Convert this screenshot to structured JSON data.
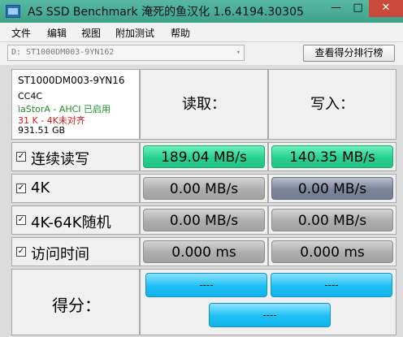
{
  "window": {
    "title": "AS SSD Benchmark 淹死的鱼汉化 1.6.4194.30305",
    "min_glyph": "—",
    "max_glyph": "□",
    "close_glyph": "✕"
  },
  "menu": [
    "文件",
    "编辑",
    "视图",
    "附加测试",
    "帮助"
  ],
  "toolbar": {
    "drive_value": "D: ST1000DM003-9YN162",
    "caret": "▾",
    "rank_button": "查看得分排行榜"
  },
  "drive_info": {
    "model": "ST1000DM003-9YN16",
    "firmware": "CC4C",
    "driver": "iaStorA - AHCI 已启用",
    "alignment": "31 K - 4K未对齐",
    "size": "931.51 GB"
  },
  "headers": {
    "read": "读取：",
    "write": "写入："
  },
  "check_glyph": "✓",
  "rows": [
    {
      "label": "连续读写",
      "read": "189.04 MB/s",
      "write": "140.35 MB/s"
    },
    {
      "label": "4K",
      "read": "0.00 MB/s",
      "write": "0.00 MB/s"
    },
    {
      "label": "4K-64K随机",
      "read": "0.00 MB/s",
      "write": "0.00 MB/s"
    },
    {
      "label": "访问时间",
      "read": "0.000 ms",
      "write": "0.000 ms"
    }
  ],
  "score": {
    "label": "得分：",
    "read": "----",
    "write": "----",
    "total": "----"
  },
  "colors": {
    "titlebar": "#3ea389",
    "close": "#c94a3c",
    "value_green": "#27d08e",
    "value_gray": "#adadad",
    "value_slate": "#7c8499",
    "score_blue": "#1cc0f5",
    "driver_green": "#1f8f2a",
    "alignment_red": "#d01c1c"
  }
}
